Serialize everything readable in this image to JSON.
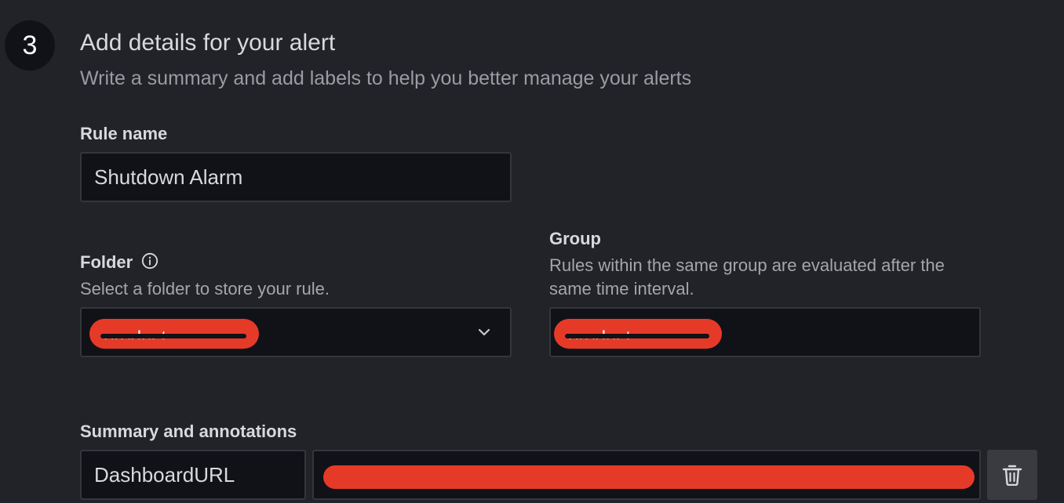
{
  "step": {
    "number": "3",
    "title": "Add details for your alert",
    "subtitle": "Write a summary and add labels to help you better manage your alerts"
  },
  "rule_name": {
    "label": "Rule name",
    "value": "Shutdown Alarm"
  },
  "folder": {
    "label": "Folder",
    "description": "Select a folder to store your rule.",
    "value_redacted": "product",
    "info_icon": "info-circle-icon",
    "dropdown_icon": "chevron-down-icon"
  },
  "group": {
    "label": "Group",
    "description": "Rules within the same group are evaluated after the same time interval.",
    "value_redacted": "product"
  },
  "summary": {
    "label": "Summary and annotations",
    "key": "DashboardURL",
    "value_redacted": "",
    "delete_icon": "trash-icon"
  },
  "colors": {
    "background": "#222328",
    "input_background": "#111217",
    "redaction": "#e63a28"
  }
}
